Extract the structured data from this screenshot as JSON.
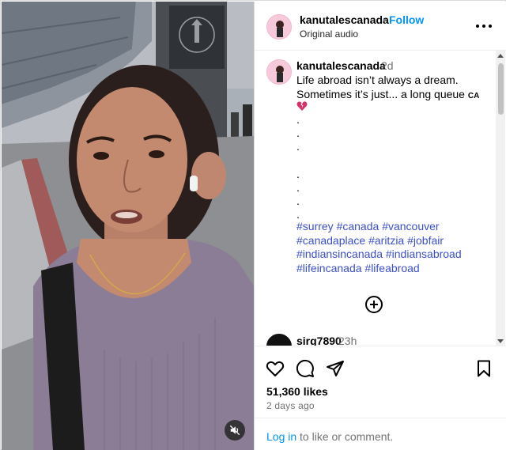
{
  "post": {
    "username": "kanutalescanada",
    "separator": "•",
    "follow_label": "Follow",
    "audio_label": "Original audio"
  },
  "caption": {
    "username": "kanutalescanada",
    "time": "2d",
    "line1": "Life abroad isn’t always a dream.",
    "line2": "Sometimes it’s just... a long queue",
    "flag_text": "CA",
    "dots": [
      ".",
      ".",
      ".",
      "",
      ".",
      ".",
      ".",
      "."
    ],
    "hashtags": [
      "#surrey",
      "#canada",
      "#vancouver",
      "#canadaplace",
      "#aritzia",
      "#jobfair",
      "#indiansincanada",
      "#indiansabroad",
      "#lifeincanada",
      "#lifeabroad"
    ]
  },
  "comment": {
    "username": "sirg7890",
    "time": "23h"
  },
  "stats": {
    "likes": "51,360 likes",
    "posted": "2 days ago"
  },
  "footer": {
    "login_link": "Log in",
    "login_rest": " to like or comment."
  },
  "colors": {
    "accent": "#0095f6",
    "hashtag": "#3b4fc9",
    "muted": "#737373"
  },
  "icons": [
    "more-options-icon",
    "broken-heart-icon",
    "add-comment-icon",
    "like-icon",
    "comment-icon",
    "share-icon",
    "save-icon",
    "muted-audio-icon"
  ]
}
